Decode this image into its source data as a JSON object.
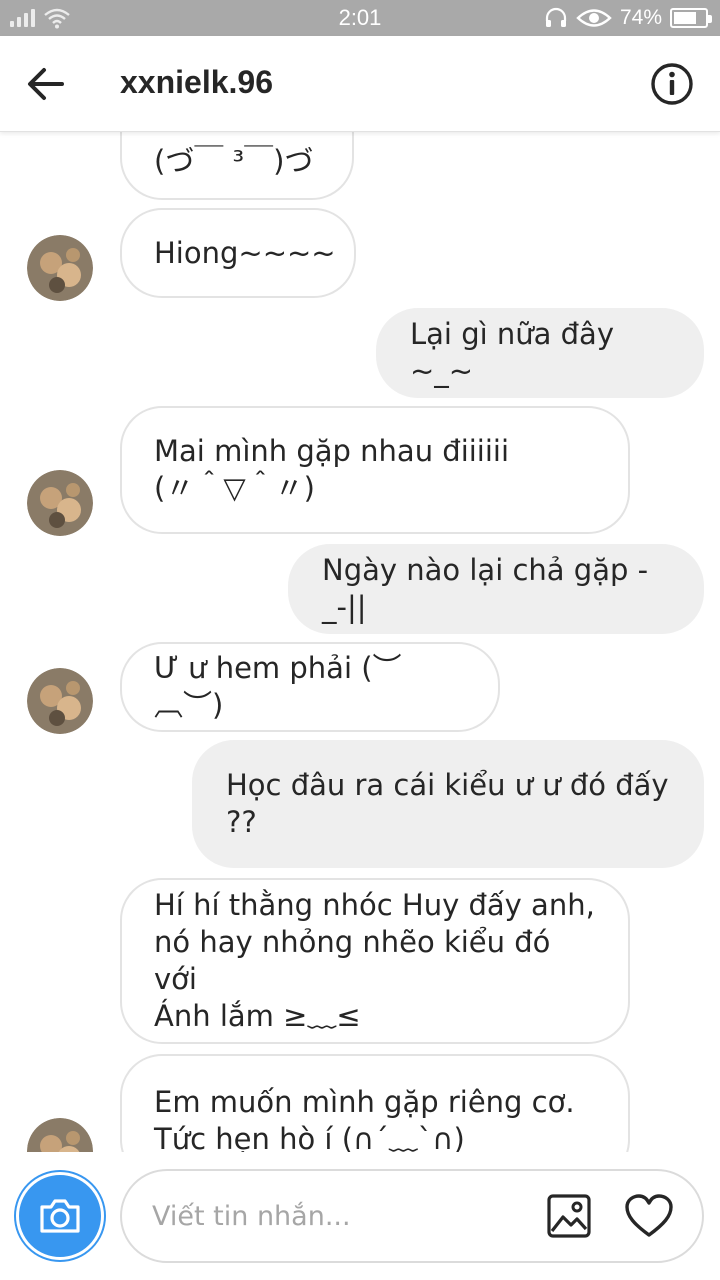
{
  "status_bar": {
    "time": "2:01",
    "battery_percent": "74%",
    "battery_level": 0.74
  },
  "header": {
    "username": "xxnielk.96",
    "back_icon": "arrow-left-icon",
    "info_icon": "info-circle-icon"
  },
  "messages": [
    {
      "direction": "incoming",
      "text": "(づ￣ ³￣)づ",
      "avatar": false
    },
    {
      "direction": "incoming",
      "text": "Hiong~~~~",
      "avatar": true
    },
    {
      "direction": "outgoing",
      "text": "Lại gì nữa đây ~_~"
    },
    {
      "direction": "incoming",
      "text": "Mai mình gặp nhau điiiiii\n(〃＾▽＾〃)",
      "avatar": true
    },
    {
      "direction": "outgoing",
      "text": "Ngày nào lại chả gặp -_-||"
    },
    {
      "direction": "incoming",
      "text": "Ư ư hem phải (︶︹︶)",
      "avatar": true
    },
    {
      "direction": "outgoing",
      "text": "Học đâu ra cái kiểu ư ư đó đấy\n??"
    },
    {
      "direction": "incoming",
      "text": "Hí hí thằng nhóc Huy đấy anh,\nnó hay nhỏng nhẽo kiểu đó với\nÁnh lắm ≥﹏≤",
      "avatar": false
    },
    {
      "direction": "incoming",
      "text": "Em muốn mình gặp riêng cơ.\nTức hẹn hò í (∩´﹏`∩)",
      "avatar": true
    }
  ],
  "composer": {
    "placeholder": "Viết tin nhắn...",
    "camera_icon": "camera-icon",
    "gallery_icon": "gallery-image-icon",
    "like_icon": "heart-icon"
  },
  "colors": {
    "accent": "#3897f0",
    "status_bar": "#a9a9a9",
    "outgoing_bubble": "#efefef",
    "incoming_border": "#e3e3e3"
  }
}
